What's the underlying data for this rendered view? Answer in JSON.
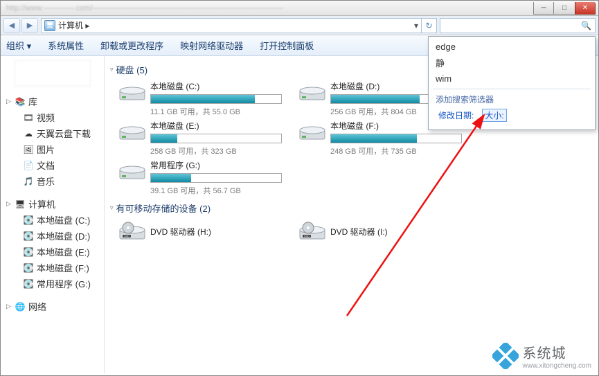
{
  "window": {
    "title": "http://www.————.com/—————————————————————————",
    "min": "─",
    "max": "□",
    "close": "✕"
  },
  "nav": {
    "back": "◀",
    "fwd": "▶",
    "path_icon": "🖥",
    "path": "计算机 ▸",
    "dropdown": "▾",
    "refresh": "↻",
    "search_icon": "🔍"
  },
  "toolbar": {
    "organize": "组织 ▾",
    "props": "系统属性",
    "uninstall": "卸载或更改程序",
    "mapdrive": "映射网络驱动器",
    "ctrlpanel": "打开控制面板"
  },
  "sidebar": {
    "lib": "库",
    "lib_items": [
      "视频",
      "天翼云盘下载",
      "图片",
      "文档",
      "音乐"
    ],
    "computer": "计算机",
    "comp_items": [
      "本地磁盘 (C:)",
      "本地磁盘 (D:)",
      "本地磁盘 (E:)",
      "本地磁盘 (F:)",
      "常用程序 (G:)"
    ],
    "network": "网络"
  },
  "content": {
    "hdd_header": "硬盘 (5)",
    "drives": [
      {
        "name": "本地磁盘 (C:)",
        "info": "11.1 GB 可用，共 55.0 GB",
        "pct": 80
      },
      {
        "name": "本地磁盘 (D:)",
        "info": "256 GB 可用，共 804 GB",
        "pct": 68
      },
      {
        "name": "本地磁盘 (E:)",
        "info": "258 GB 可用，共 323 GB",
        "pct": 20
      },
      {
        "name": "本地磁盘 (F:)",
        "info": "248 GB 可用，共 735 GB",
        "pct": 66
      },
      {
        "name": "常用程序 (G:)",
        "info": "39.1 GB 可用，共 56.7 GB",
        "pct": 31
      }
    ],
    "removable_header": "有可移动存储的设备 (2)",
    "dvds": [
      "DVD 驱动器 (H:)",
      "DVD 驱动器 (I:)"
    ]
  },
  "dropdown": {
    "items": [
      "edge",
      "静",
      "wim"
    ],
    "add_filter": "添加搜索筛选器",
    "mod_date": "修改日期:",
    "size": "大小:"
  },
  "watermark": {
    "brand": "系统城",
    "url": "www.xitongcheng.com"
  }
}
